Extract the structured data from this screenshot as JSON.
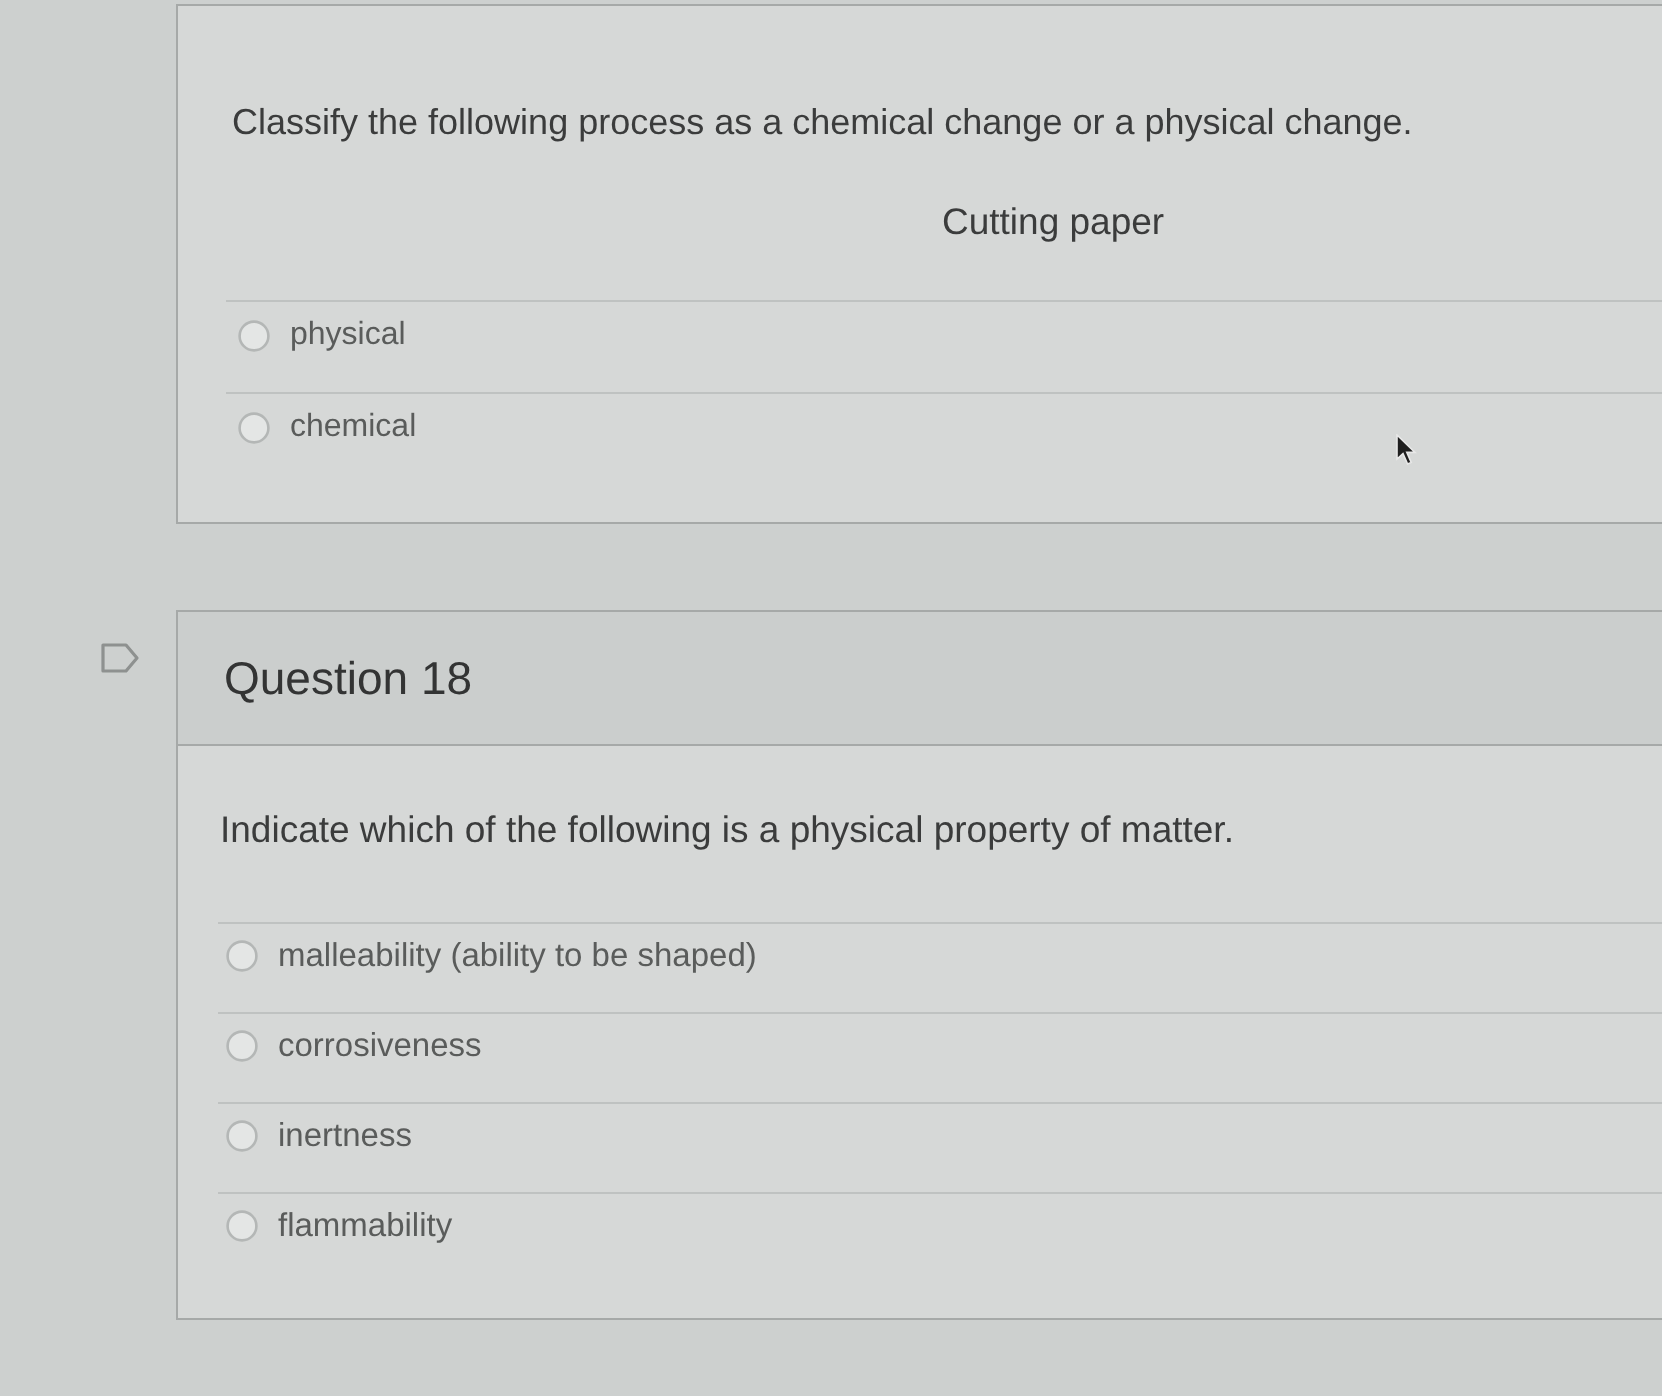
{
  "questions": [
    {
      "kind": "plain",
      "prompt": "Classify the following process as a chemical change or a physical change.",
      "item": "Cutting paper",
      "options": [
        {
          "label": "physical",
          "selected": false
        },
        {
          "label": "chemical",
          "selected": false
        }
      ]
    },
    {
      "kind": "headed",
      "flagged": false,
      "title": "Question 18",
      "prompt": "Indicate which of the following is a physical property of matter.",
      "options": [
        {
          "label": "malleability (ability to be shaped)",
          "selected": false
        },
        {
          "label": "corrosiveness",
          "selected": false
        },
        {
          "label": "inertness",
          "selected": false
        },
        {
          "label": "flammability",
          "selected": false
        }
      ]
    }
  ]
}
